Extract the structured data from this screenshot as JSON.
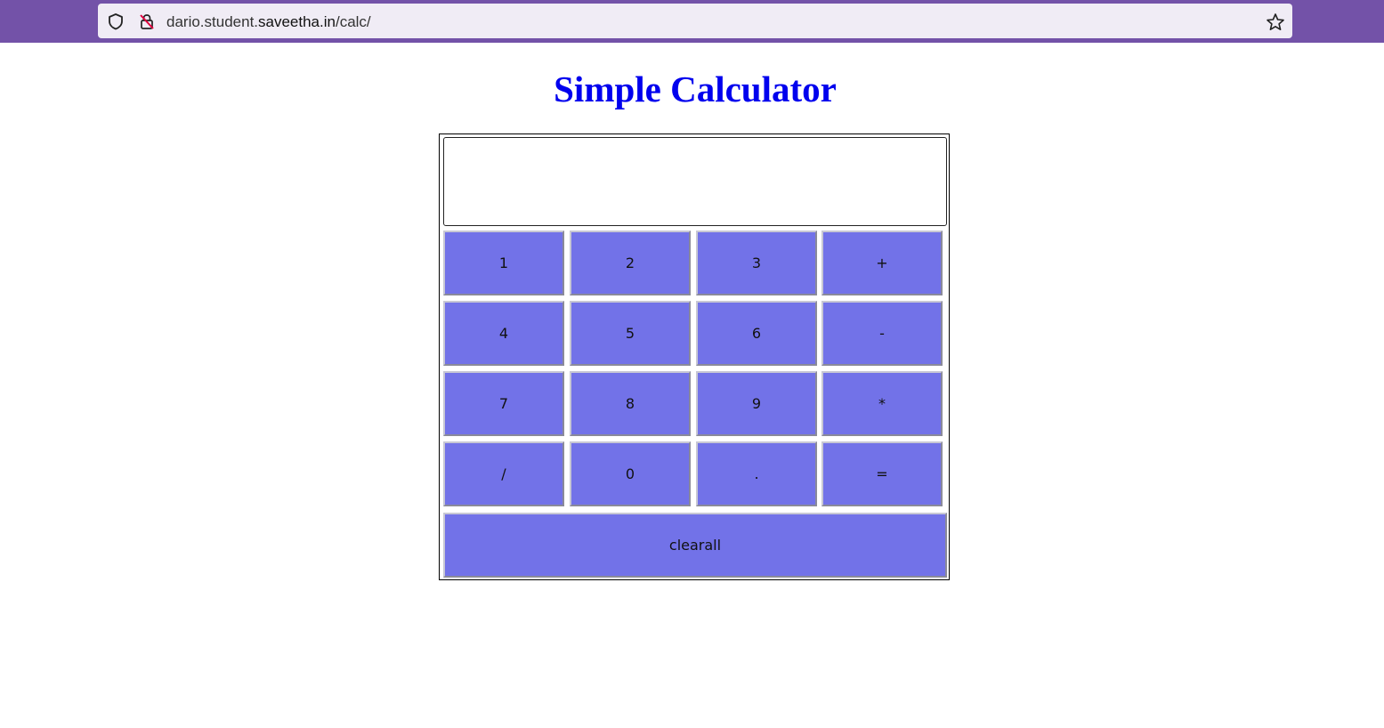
{
  "browser": {
    "url_prefix": "dario.student.",
    "url_host": "saveetha.in",
    "url_path": "/calc/",
    "icons": [
      "shield-icon",
      "insecure-lock-icon",
      "bookmark-star-icon"
    ]
  },
  "page": {
    "title": "Simple Calculator"
  },
  "calculator": {
    "display_value": "",
    "keys": [
      {
        "label": "1",
        "name": "key-1"
      },
      {
        "label": "2",
        "name": "key-2"
      },
      {
        "label": "3",
        "name": "key-3"
      },
      {
        "label": "+",
        "name": "key-plus"
      },
      {
        "label": "4",
        "name": "key-4"
      },
      {
        "label": "5",
        "name": "key-5"
      },
      {
        "label": "6",
        "name": "key-6"
      },
      {
        "label": "-",
        "name": "key-minus"
      },
      {
        "label": "7",
        "name": "key-7"
      },
      {
        "label": "8",
        "name": "key-8"
      },
      {
        "label": "9",
        "name": "key-9"
      },
      {
        "label": "*",
        "name": "key-multiply"
      },
      {
        "label": "/",
        "name": "key-divide"
      },
      {
        "label": "0",
        "name": "key-0"
      },
      {
        "label": ".",
        "name": "key-decimal"
      },
      {
        "label": "=",
        "name": "key-equals"
      }
    ],
    "clear_label": "clearall"
  },
  "colors": {
    "browser_bar": "#7352a8",
    "title": "#0000ee",
    "key_bg": "#7272e8"
  }
}
